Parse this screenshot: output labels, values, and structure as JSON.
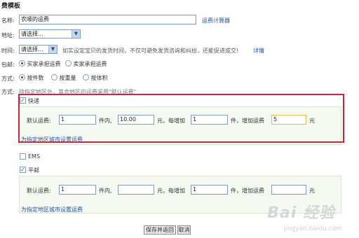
{
  "page": {
    "title": "费模板"
  },
  "form": {
    "name_label": "名称:",
    "name_value": "农顺的运费",
    "calc_link": "运费计算器",
    "address_label": "地址:",
    "address_select": "请选择...",
    "time_label": "时间:",
    "time_select": "请选择...",
    "time_hint": "如实设定宝贝的发货时间，不仅可避免发货咨询和纠纷，还能促进成交!",
    "detail_link": "详情",
    "shipping_label": "包邮:",
    "shipping_opt_buyer": "买家承担运费",
    "shipping_opt_seller": "卖家承担运费",
    "pricing_label": "方式:",
    "pricing_opt_piece": "按件数",
    "pricing_opt_weight": "按重量",
    "pricing_opt_volume": "按体积",
    "method_label": "方式:",
    "method_hint": "除指定地区外，其余地区的运费采用\"默认运费\""
  },
  "express": {
    "checkbox_label": "快递",
    "checked": true,
    "default_fee_label": "默认运费:",
    "first_qty": "1",
    "unit_within": "件内,",
    "first_fee": "10.00",
    "unit_yuan_each": "元，每增加",
    "add_qty": "1",
    "unit_piece_add_fee": "件，增加运费",
    "add_fee": "5",
    "unit_yuan": "元",
    "region_link": "为指定地区城市设置运费"
  },
  "ems": {
    "checkbox_label": "EMS",
    "checked": false
  },
  "pingyou": {
    "checkbox_label": "平邮",
    "checked": true,
    "default_fee_label": "默认运费:",
    "first_qty": "1",
    "unit_within": "件内,",
    "first_fee": "",
    "unit_yuan_each": "元，每增加",
    "add_qty": "1",
    "unit_piece_add_fee": "件，增加运费",
    "add_fee": "",
    "unit_yuan": "元",
    "region_link": "为指定地区城市设置运费"
  },
  "buttons": {
    "save_return": "保存并返回",
    "cancel": "取消"
  },
  "watermark": {
    "logo": "Bai 经验",
    "url": "jingyan.baidu.com"
  },
  "colors": {
    "highlight": "#c8283a",
    "link": "#1a56a8",
    "panel_bg": "#f4faf2"
  }
}
